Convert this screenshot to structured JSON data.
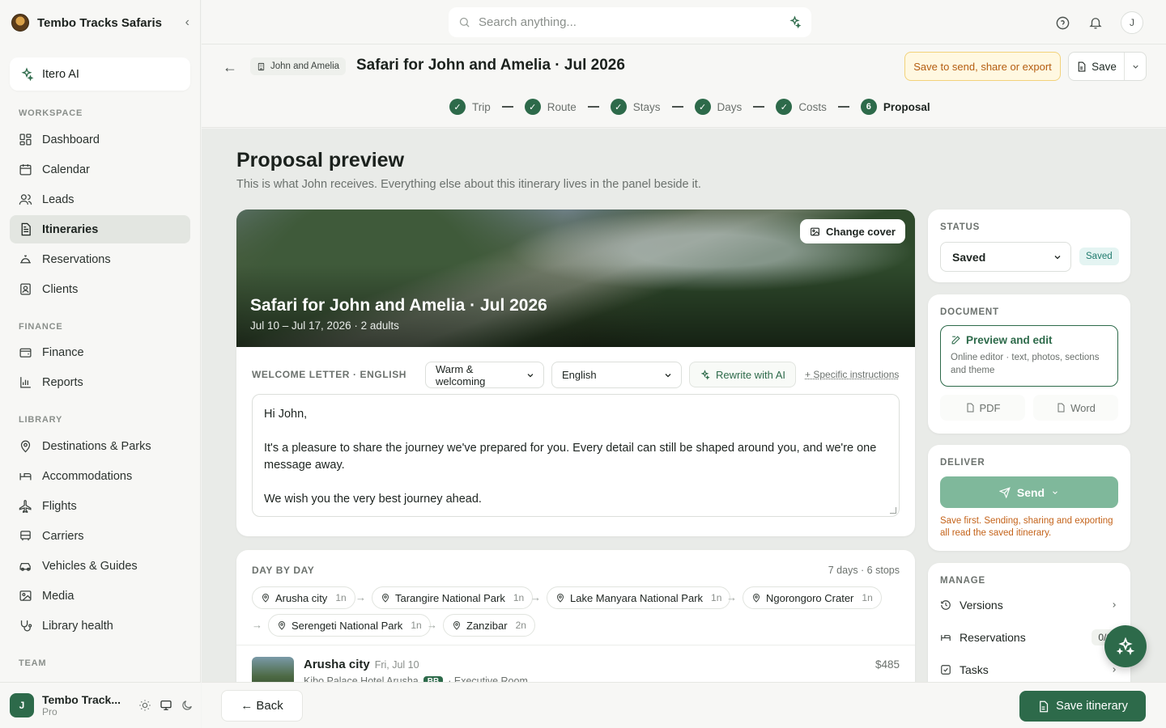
{
  "brand": {
    "name": "Tembo Tracks Safaris"
  },
  "ai": {
    "label": "Itero AI"
  },
  "sidebar": {
    "workspace_title": "WORKSPACE",
    "workspace": [
      {
        "label": "Dashboard",
        "icon": "dashboard-icon"
      },
      {
        "label": "Calendar",
        "icon": "calendar-icon"
      },
      {
        "label": "Leads",
        "icon": "users-icon"
      },
      {
        "label": "Itineraries",
        "icon": "document-icon"
      },
      {
        "label": "Reservations",
        "icon": "bell-desk-icon"
      },
      {
        "label": "Clients",
        "icon": "contact-icon"
      }
    ],
    "finance_title": "FINANCE",
    "finance": [
      {
        "label": "Finance",
        "icon": "wallet-icon"
      },
      {
        "label": "Reports",
        "icon": "bar-chart-icon"
      }
    ],
    "library_title": "LIBRARY",
    "library": [
      {
        "label": "Destinations & Parks",
        "icon": "pin-icon"
      },
      {
        "label": "Accommodations",
        "icon": "bed-icon"
      },
      {
        "label": "Flights",
        "icon": "plane-icon"
      },
      {
        "label": "Carriers",
        "icon": "bus-icon"
      },
      {
        "label": "Vehicles & Guides",
        "icon": "car-icon"
      },
      {
        "label": "Media",
        "icon": "image-icon"
      },
      {
        "label": "Library health",
        "icon": "stethoscope-icon"
      }
    ],
    "team_title": "TEAM",
    "account": {
      "initial": "J",
      "name": "Tembo Track...",
      "plan": "Pro"
    }
  },
  "topbar": {
    "search_placeholder": "Search anything...",
    "user_initial": "J"
  },
  "header": {
    "client": "John and Amelia",
    "title": "Safari for John and Amelia · Jul 2026",
    "warning": "Save to send, share or export",
    "save": "Save"
  },
  "steps": [
    {
      "label": "Trip",
      "marker": "✓"
    },
    {
      "label": "Route",
      "marker": "✓"
    },
    {
      "label": "Stays",
      "marker": "✓"
    },
    {
      "label": "Days",
      "marker": "✓"
    },
    {
      "label": "Costs",
      "marker": "✓"
    },
    {
      "label": "Proposal",
      "marker": "6"
    }
  ],
  "page": {
    "title": "Proposal preview",
    "subtitle": "This is what John receives. Everything else about this itinerary lives in the panel beside it."
  },
  "cover": {
    "change_label": "Change cover",
    "title": "Safari for John and Amelia · Jul 2026",
    "subtitle": "Jul 10 – Jul 17, 2026 · 2 adults"
  },
  "letter": {
    "label": "WELCOME LETTER · ENGLISH",
    "tone": "Warm & welcoming",
    "language": "English",
    "rewrite": "Rewrite with AI",
    "specific": "+ Specific instructions",
    "greeting": "Hi John,",
    "body": "It's a pleasure to share the journey we've prepared for you. Every detail can still be shaped around you, and we're one message away.",
    "closing": "We wish you the very best journey ahead."
  },
  "day_by_day": {
    "title": "DAY BY DAY",
    "meta": "7 days · 6 stops",
    "stops": [
      {
        "name": "Arusha city",
        "nights": "1n"
      },
      {
        "name": "Tarangire National Park",
        "nights": "1n"
      },
      {
        "name": "Lake Manyara National Park",
        "nights": "1n"
      },
      {
        "name": "Ngorongoro Crater",
        "nights": "1n"
      },
      {
        "name": "Serengeti National Park",
        "nights": "1n"
      },
      {
        "name": "Zanzibar",
        "nights": "2n"
      }
    ],
    "first_day": {
      "name": "Arusha city",
      "date": "Fri, Jul 10",
      "hotel": "Kibo Palace Hotel Arusha",
      "board": "BB",
      "room": "· Executive Room",
      "price": "$485"
    }
  },
  "status": {
    "title": "STATUS",
    "value": "Saved",
    "badge": "Saved"
  },
  "document": {
    "title": "DOCUMENT",
    "preview_title": "Preview and edit",
    "preview_sub": "Online editor · text, photos, sections and theme",
    "pdf": "PDF",
    "word": "Word"
  },
  "deliver": {
    "title": "DELIVER",
    "send": "Send",
    "note": "Save first. Sending, sharing and exporting all read the saved itinerary."
  },
  "manage": {
    "title": "MANAGE",
    "versions": "Versions",
    "reservations": "Reservations",
    "reservations_count": "0/6",
    "tasks": "Tasks"
  },
  "footer": {
    "back": "← Back",
    "save": "Save itinerary"
  },
  "colors": {
    "brand": "#2d6a4a",
    "warning": "#b45d10",
    "send_disabled": "#7fb89b"
  }
}
